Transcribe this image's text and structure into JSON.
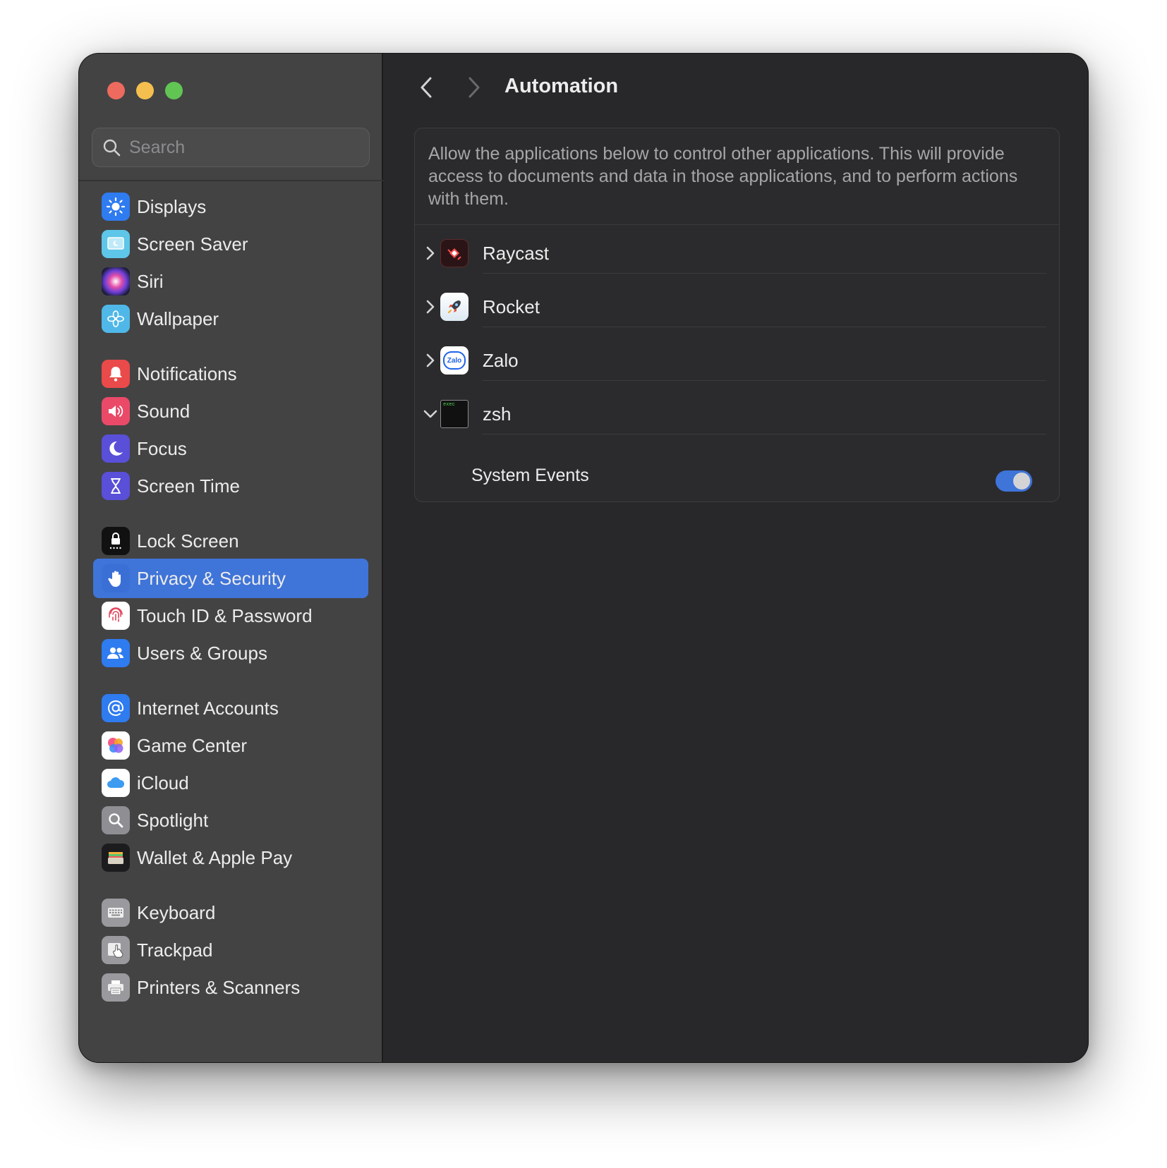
{
  "window": {
    "search": {
      "placeholder": "Search"
    },
    "sidebar": {
      "items": [
        {
          "label": "Displays",
          "icon": "displays-icon"
        },
        {
          "label": "Screen Saver",
          "icon": "screen-saver-icon"
        },
        {
          "label": "Siri",
          "icon": "siri-icon"
        },
        {
          "label": "Wallpaper",
          "icon": "wallpaper-icon"
        },
        {
          "label": "Notifications",
          "icon": "notifications-icon"
        },
        {
          "label": "Sound",
          "icon": "sound-icon"
        },
        {
          "label": "Focus",
          "icon": "focus-icon"
        },
        {
          "label": "Screen Time",
          "icon": "screen-time-icon"
        },
        {
          "label": "Lock Screen",
          "icon": "lock-screen-icon"
        },
        {
          "label": "Privacy & Security",
          "icon": "privacy-hand-icon",
          "selected": true
        },
        {
          "label": "Touch ID & Password",
          "icon": "fingerprint-icon"
        },
        {
          "label": "Users & Groups",
          "icon": "users-icon"
        },
        {
          "label": "Internet Accounts",
          "icon": "at-sign-icon"
        },
        {
          "label": "Game Center",
          "icon": "game-center-icon"
        },
        {
          "label": "iCloud",
          "icon": "icloud-icon"
        },
        {
          "label": "Spotlight",
          "icon": "spotlight-icon"
        },
        {
          "label": "Wallet & Apple Pay",
          "icon": "wallet-icon"
        },
        {
          "label": "Keyboard",
          "icon": "keyboard-icon"
        },
        {
          "label": "Trackpad",
          "icon": "trackpad-icon"
        },
        {
          "label": "Printers & Scanners",
          "icon": "printer-icon"
        }
      ]
    }
  },
  "main": {
    "title": "Automation",
    "description": "Allow the applications below to control other applications. This will provide access to documents and data in those applications, and to perform actions with them.",
    "apps": [
      {
        "name": "Raycast",
        "expanded": false,
        "icon": "raycast-icon"
      },
      {
        "name": "Rocket",
        "expanded": false,
        "icon": "rocket-icon"
      },
      {
        "name": "Zalo",
        "expanded": false,
        "icon": "zalo-icon",
        "icon_text": "Zalo"
      },
      {
        "name": "zsh",
        "expanded": true,
        "icon": "terminal-exec-icon",
        "icon_text": "exec"
      }
    ],
    "sub_items": [
      {
        "label": "System Events",
        "enabled": true
      }
    ]
  },
  "colors": {
    "accent": "#3f74d9",
    "sidebar_bg": "#434344",
    "main_bg": "#28282a"
  }
}
